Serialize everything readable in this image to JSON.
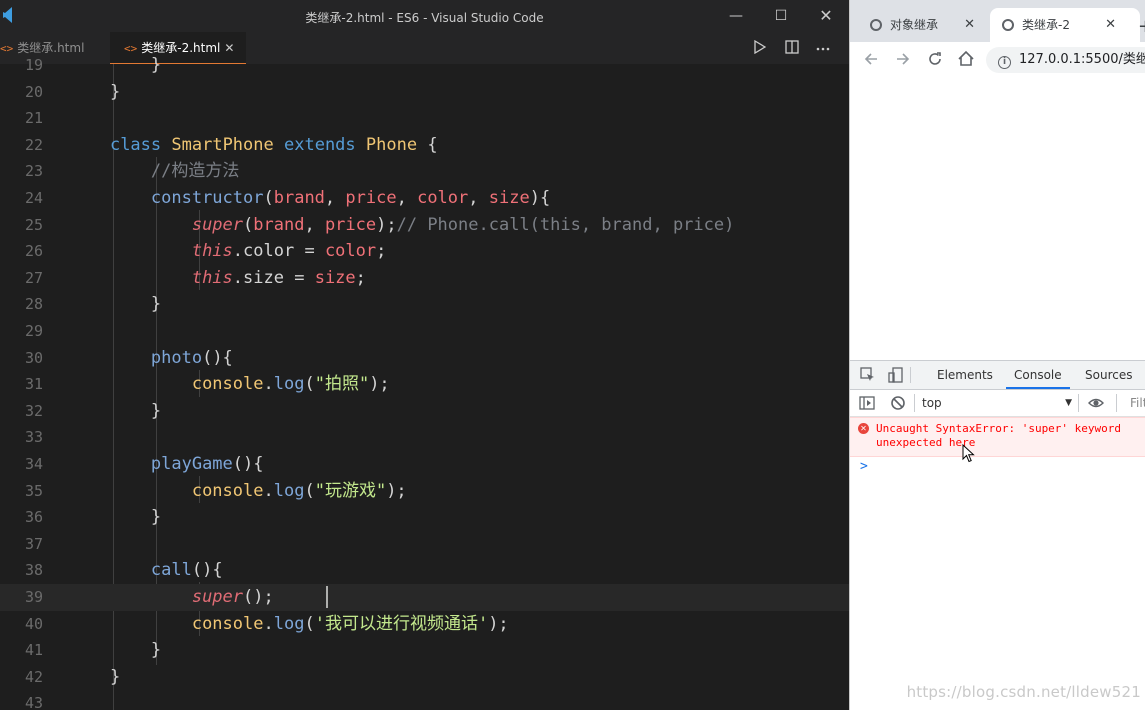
{
  "vscode": {
    "window_title": "类继承-2.html - ES6 - Visual Studio Code",
    "tabs": [
      {
        "label": "类继承.html",
        "icon": "<>",
        "active": false
      },
      {
        "label": "类继承-2.html",
        "icon": "<>",
        "active": true,
        "close": "✕"
      }
    ],
    "controls": {
      "minimize": "—",
      "maximize": "☐",
      "close": "✕"
    },
    "editor_lines": [
      {
        "n": "19",
        "text": "        }"
      },
      {
        "n": "20",
        "text": "    }"
      },
      {
        "n": "21",
        "text": ""
      },
      {
        "n": "22",
        "text": "    class SmartPhone extends Phone {"
      },
      {
        "n": "23",
        "text": "        //构造方法"
      },
      {
        "n": "24",
        "text": "        constructor(brand, price, color, size){"
      },
      {
        "n": "25",
        "text": "            super(brand, price);// Phone.call(this, brand, price)"
      },
      {
        "n": "26",
        "text": "            this.color = color;"
      },
      {
        "n": "27",
        "text": "            this.size = size;"
      },
      {
        "n": "28",
        "text": "        }"
      },
      {
        "n": "29",
        "text": ""
      },
      {
        "n": "30",
        "text": "        photo(){"
      },
      {
        "n": "31",
        "text": "            console.log(\"拍照\");"
      },
      {
        "n": "32",
        "text": "        }"
      },
      {
        "n": "33",
        "text": ""
      },
      {
        "n": "34",
        "text": "        playGame(){"
      },
      {
        "n": "35",
        "text": "            console.log(\"玩游戏\");"
      },
      {
        "n": "36",
        "text": "        }"
      },
      {
        "n": "37",
        "text": ""
      },
      {
        "n": "38",
        "text": "        call(){"
      },
      {
        "n": "39",
        "text": "            super();"
      },
      {
        "n": "40",
        "text": "            console.log('我可以进行视频通话');"
      },
      {
        "n": "41",
        "text": "        }"
      },
      {
        "n": "42",
        "text": "    }"
      },
      {
        "n": "43",
        "text": ""
      }
    ]
  },
  "browser": {
    "tabs": [
      {
        "label": "对象继承",
        "close": "✕"
      },
      {
        "label": "类继承-2",
        "close": "✕"
      }
    ],
    "new_tab": "+",
    "url": "127.0.0.1:5500/类继",
    "devtools": {
      "tabs": [
        "Elements",
        "Console",
        "Sources"
      ],
      "active_tab": "Console",
      "context": "top",
      "filter_placeholder": "Filt",
      "error_line1": "Uncaught SyntaxError: 'super' keyword",
      "error_line2": "unexpected here",
      "prompt": ">"
    }
  },
  "watermark": "https://blog.csdn.net/lldew521",
  "colors": {
    "editor_bg": "#1e1e1e",
    "accent_tab": "#e37933",
    "error_text": "#ff0000",
    "devtools_active": "#1a73e8"
  }
}
